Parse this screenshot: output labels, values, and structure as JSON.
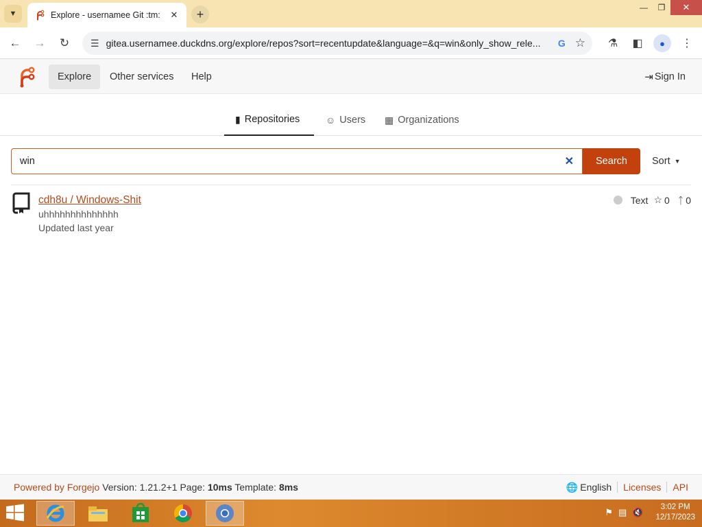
{
  "browser": {
    "tab_title": "Explore - usernamee Git :tm:",
    "url": "gitea.usernamee.duckdns.org/explore/repos?sort=recentupdate&language=&q=win&only_show_rele..."
  },
  "header": {
    "nav": [
      "Explore",
      "Other services",
      "Help"
    ],
    "sign_in": "Sign In"
  },
  "sub_tabs": [
    "Repositories",
    "Users",
    "Organizations"
  ],
  "search": {
    "value": "win",
    "button": "Search",
    "sort": "Sort"
  },
  "repos": [
    {
      "name": "cdh8u / Windows-Shit",
      "description": "uhhhhhhhhhhhhhh",
      "updated": "Updated last year",
      "language": "Text",
      "stars": "0",
      "forks": "0"
    }
  ],
  "footer": {
    "powered": "Powered by Forgejo",
    "version": "Version: 1.21.2+1 Page:",
    "page_time": "10ms",
    "template_label": "Template:",
    "template_time": "8ms",
    "language": "English",
    "licenses": "Licenses",
    "api": "API"
  },
  "taskbar": {
    "time": "3:02 PM",
    "date": "12/17/2023"
  },
  "colors": {
    "accent": "#c2410c",
    "link": "#b34a1a",
    "tabstrip": "#f7e4b2",
    "taskbar": "#dd8a2f"
  }
}
